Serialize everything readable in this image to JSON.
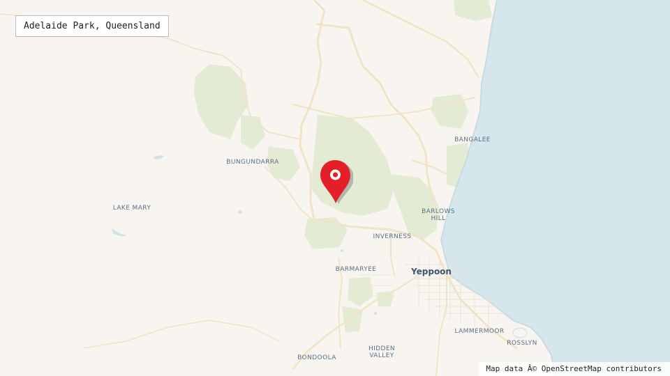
{
  "map": {
    "title": "Adelaide Park, Queensland",
    "attribution": "Map data Â© OpenStreetMap contributors",
    "colors": {
      "land": "#f8f5f0",
      "sea": "#d5e6ec",
      "forest": "#e2ead3",
      "road": "#f0e3c4",
      "marker": "#e3202a"
    },
    "places": {
      "bungundarra": "BUNGUNDARRA",
      "bangalee": "BANGALEE",
      "lake_mary": "LAKE MARY",
      "barlows_hill": "BARLOWS\nHILL",
      "inverness": "INVERNESS",
      "barmaryee": "BARMARYEE",
      "yeppoon": "Yeppoon",
      "lammermoor": "LAMMERMOOR",
      "rosslyn": "ROSSLYN",
      "hidden_valley": "HIDDEN\nVALLEY",
      "bondoola": "BONDOOLA"
    },
    "marker_icon": "map-pin-icon"
  }
}
